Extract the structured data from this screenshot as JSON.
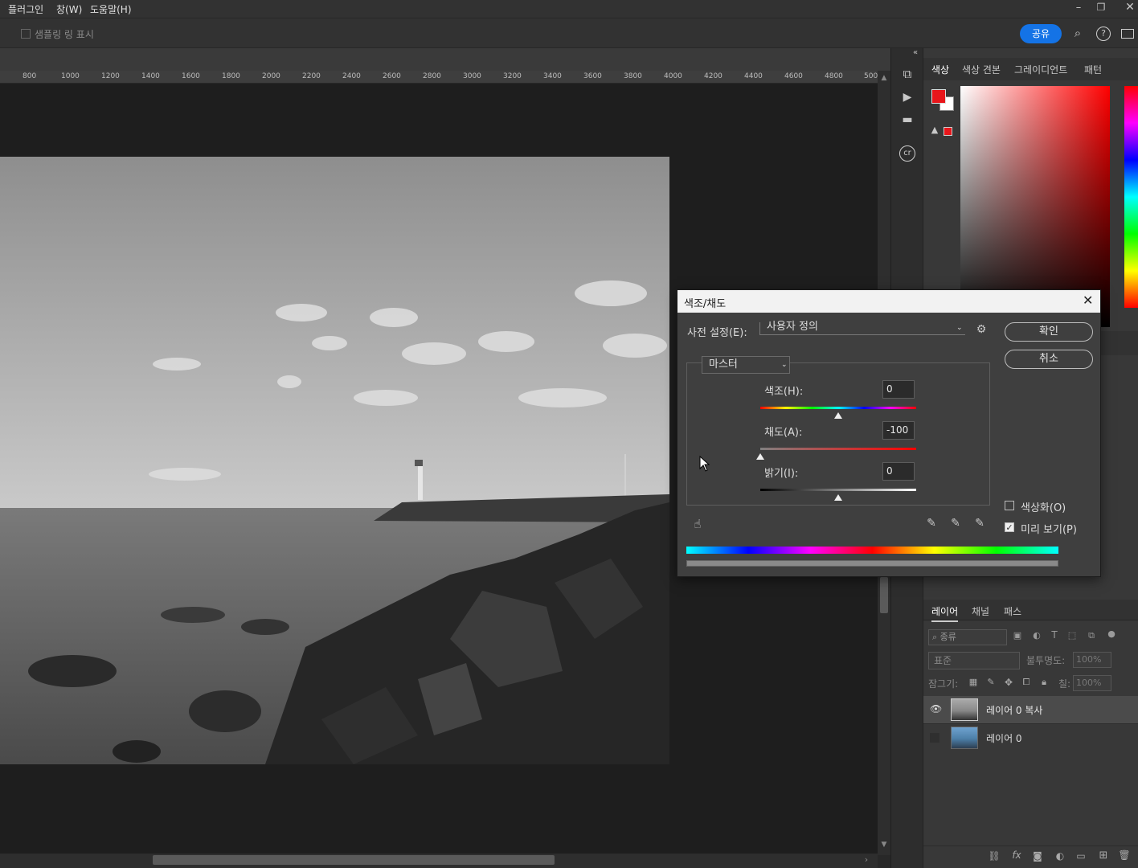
{
  "menubar": {
    "items": [
      "플러그인",
      "창(W)",
      "도움말(H)"
    ]
  },
  "optbar": {
    "sampling_ring": "샘플링 링 표시",
    "share": "공유"
  },
  "ruler": {
    "labels": [
      "800",
      "1000",
      "1200",
      "1400",
      "1600",
      "1800",
      "2000",
      "2200",
      "2400",
      "2600",
      "2800",
      "3000",
      "3200",
      "3400",
      "3600",
      "3800",
      "4000",
      "4200",
      "4400",
      "4600",
      "4800",
      "500"
    ]
  },
  "color_panel": {
    "tabs": [
      "색상",
      "색상 견본",
      "그레이디언트",
      "패턴"
    ],
    "foreground": "#e8161b",
    "background": "#ffffff"
  },
  "dialog": {
    "title": "색조/채도",
    "preset_label": "사전 설정(E):",
    "preset_value": "사용자 정의",
    "ok": "확인",
    "cancel": "취소",
    "channel": "마스터",
    "hue_label": "색조(H):",
    "hue_value": "0",
    "hue_pos": 0.5,
    "sat_label": "채도(A):",
    "sat_value": "-100",
    "sat_pos": 0.0,
    "light_label": "밝기(I):",
    "light_value": "0",
    "light_pos": 0.5,
    "colorize_label": "색상화(O)",
    "colorize_checked": false,
    "preview_label": "미리 보기(P)",
    "preview_checked": true
  },
  "layers_panel": {
    "tabs": [
      "레이어",
      "채널",
      "패스"
    ],
    "filter_label": "종류",
    "blend_mode": "표준",
    "opacity_label": "불투명도:",
    "opacity_value": "100%",
    "lock_label": "잠그기:",
    "fill_label": "칠:",
    "fill_value": "100%",
    "layers": [
      {
        "name": "레이어 0 복사",
        "visible": true,
        "selected": true
      },
      {
        "name": "레이어 0",
        "visible": false,
        "selected": false
      }
    ]
  }
}
